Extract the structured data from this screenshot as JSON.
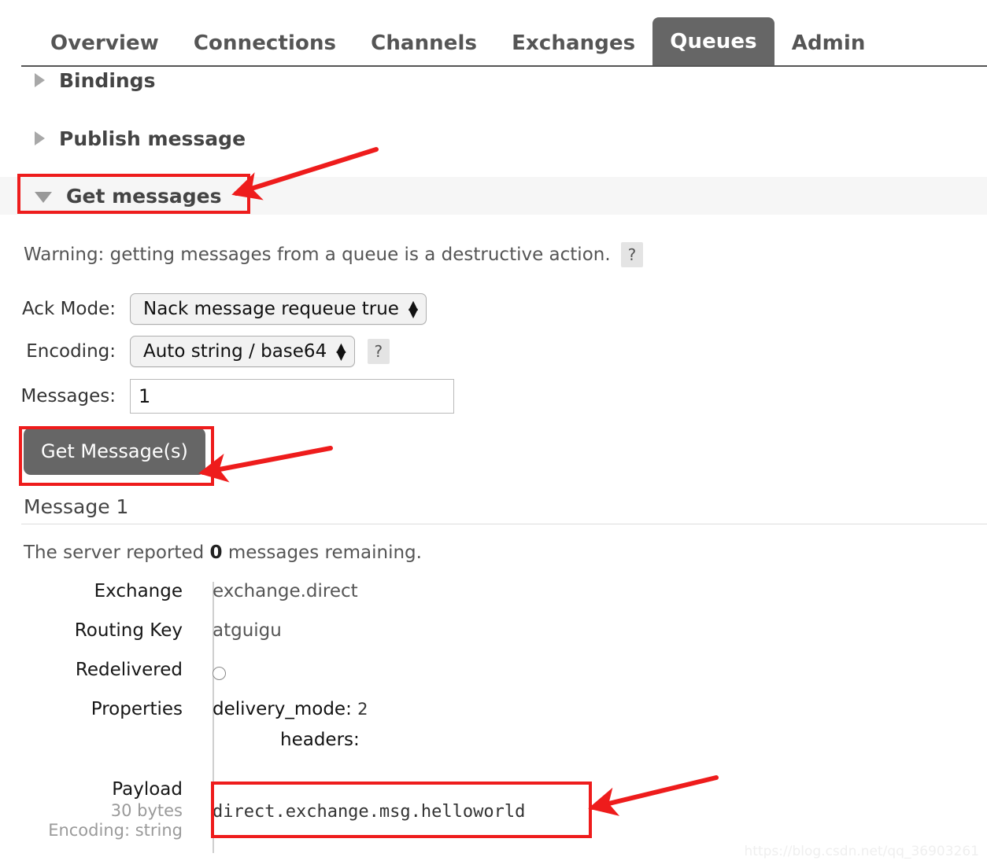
{
  "nav": {
    "items": [
      {
        "label": "Overview",
        "active": false
      },
      {
        "label": "Connections",
        "active": false
      },
      {
        "label": "Channels",
        "active": false
      },
      {
        "label": "Exchanges",
        "active": false
      },
      {
        "label": "Queues",
        "active": true
      },
      {
        "label": "Admin",
        "active": false
      }
    ]
  },
  "sections": {
    "bindings": {
      "title": "Bindings",
      "state": "collapsed"
    },
    "publish": {
      "title": "Publish message",
      "state": "collapsed"
    },
    "get": {
      "title": "Get messages",
      "state": "expanded"
    }
  },
  "get_messages": {
    "warning_text": "Warning: getting messages from a queue is a destructive action.",
    "warning_help": "?",
    "ack_mode": {
      "label": "Ack Mode:",
      "value": "Nack message requeue true"
    },
    "encoding": {
      "label": "Encoding:",
      "value": "Auto string / base64",
      "help": "?"
    },
    "messages": {
      "label": "Messages:",
      "value": "1"
    },
    "get_button_label": "Get Message(s)"
  },
  "result": {
    "heading": "Message 1",
    "server_report_prefix": "The server reported ",
    "server_report_count": "0",
    "server_report_suffix": " messages remaining.",
    "rows": [
      {
        "label": "Exchange",
        "value": "exchange.direct"
      },
      {
        "label": "Routing Key",
        "value": "atguigu"
      },
      {
        "label": "Redelivered",
        "value": ""
      }
    ],
    "properties": {
      "label": "Properties",
      "delivery_mode_key": "delivery_mode:",
      "delivery_mode_value": "2",
      "headers_key": "headers:"
    },
    "payload": {
      "label": "Payload",
      "size": "30 bytes",
      "encoding": "Encoding: string",
      "value": "direct.exchange.msg.helloworld"
    }
  },
  "colors": {
    "annotation": "#ee1c1c",
    "active_tab": "#666666",
    "section_band": "#f6f6f6"
  },
  "watermark": {
    "text": "https://blog.csdn.net/qq_36903261"
  }
}
